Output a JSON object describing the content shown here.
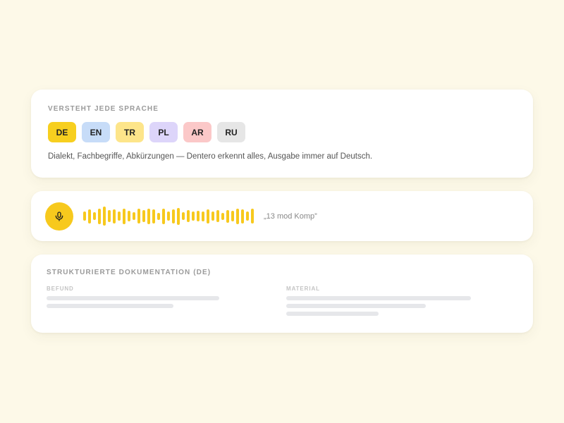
{
  "colors": {
    "background": "#fdf9e8",
    "accent": "#f7c91d",
    "placeholder": "#e6e7ea"
  },
  "languages_card": {
    "title": "VERSTEHT JEDE SPRACHE",
    "chips": [
      {
        "code": "DE",
        "color": "#f7cf1f"
      },
      {
        "code": "EN",
        "color": "#c7dcf8"
      },
      {
        "code": "TR",
        "color": "#fde58a"
      },
      {
        "code": "PL",
        "color": "#ddd5fa"
      },
      {
        "code": "AR",
        "color": "#fbc8c8"
      },
      {
        "code": "RU",
        "color": "#e6e6e6"
      }
    ],
    "description": "Dialekt, Fachbegriffe, Abkürzungen — Dentero erkennt alles, Ausgabe immer auf Deutsch."
  },
  "voice_card": {
    "mic_icon": "microphone-icon",
    "waveform_levels": [
      0.45,
      0.7,
      0.4,
      0.8,
      0.95,
      0.6,
      0.7,
      0.45,
      0.8,
      0.55,
      0.4,
      0.75,
      0.6,
      0.8,
      0.7,
      0.35,
      0.8,
      0.45,
      0.7,
      0.85,
      0.4,
      0.6,
      0.45,
      0.55,
      0.5,
      0.7,
      0.45,
      0.6,
      0.35,
      0.65,
      0.55,
      0.8,
      0.7,
      0.45,
      0.75
    ],
    "transcript": "„13 mod Komp”"
  },
  "doc_card": {
    "title": "STRUKTURIERTE DOKUMENTATION (DE)",
    "columns": [
      {
        "label": "BEFUND",
        "lines": [
          0.72,
          0.53
        ]
      },
      {
        "label": "MATERIAL",
        "lines": [
          0.82,
          0.62,
          0.41
        ]
      }
    ]
  }
}
